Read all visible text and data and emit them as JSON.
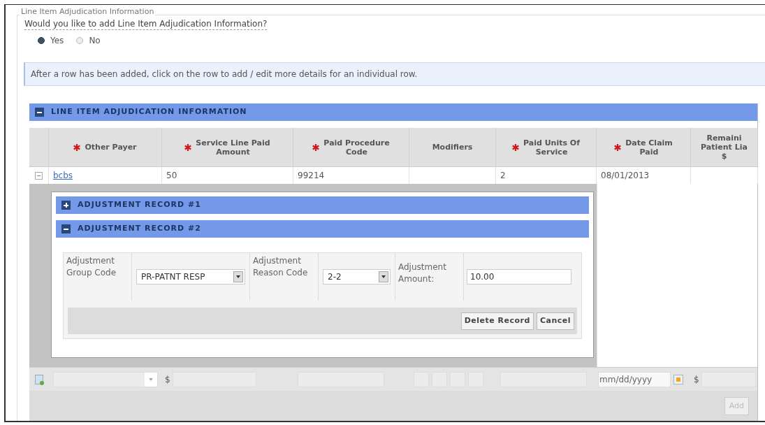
{
  "fieldset": {
    "legend": "Line Item Adjudication Information"
  },
  "question": {
    "label": "Would you like to add Line Item Adjudication Information?",
    "options": [
      {
        "label": "Yes",
        "selected": true
      },
      {
        "label": "No",
        "selected": false
      }
    ]
  },
  "info_message": "After a row has been added, click on the row to add / edit more details for an individual row.",
  "grid": {
    "title": "LINE ITEM ADJUDICATION INFORMATION",
    "expanded": true,
    "columns": [
      {
        "label": "Other Payer",
        "required": true
      },
      {
        "label": "Service Line Paid\nAmount",
        "required": true
      },
      {
        "label": "Paid Procedure\nCode",
        "required": true
      },
      {
        "label": "Modifiers",
        "required": false
      },
      {
        "label": "Paid Units Of\nService",
        "required": true
      },
      {
        "label": "Date Claim\nPaid",
        "required": true
      },
      {
        "label": "Remaini\nPatient Lia\n$",
        "required": false
      }
    ],
    "rows": [
      {
        "cells": [
          "bcbs",
          "50",
          "99214",
          null,
          "2",
          "08/01/2013",
          null
        ],
        "expanded": true,
        "adjustments": [
          {
            "title": "ADJUSTMENT RECORD #1",
            "expanded": false
          },
          {
            "title": "ADJUSTMENT RECORD #2",
            "expanded": true,
            "group_code_label": "Adjustment Group Code",
            "group_code_value": "PR-PATNT RESP",
            "reason_code_label": "Adjustment Reason Code",
            "reason_code_value": "2-2",
            "amount_label": "Adjustment Amount:",
            "amount_value": "10.00",
            "buttons": [
              "Delete Record",
              "Cancel"
            ]
          }
        ]
      }
    ],
    "new_row": {
      "amount_prefix": "$",
      "date_placeholder": "mm/dd/yyyy",
      "liability_prefix": "$"
    },
    "add_button": {
      "label": "Add",
      "disabled": true
    }
  }
}
